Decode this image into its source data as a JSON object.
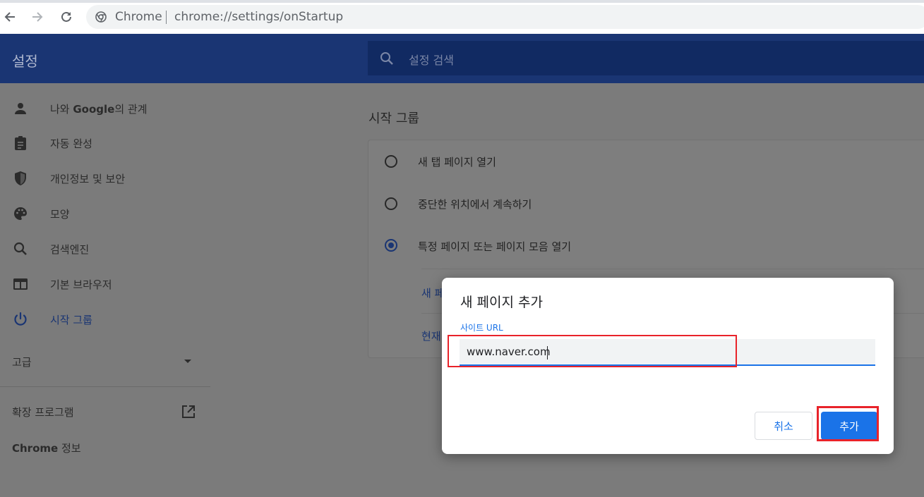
{
  "browser": {
    "chrome_label": "Chrome",
    "url": "chrome://settings/onStartup"
  },
  "header": {
    "title": "설정",
    "search_placeholder": "설정 검색"
  },
  "sidebar": {
    "items": [
      {
        "label_pre": "나와 ",
        "label_bold": "Google",
        "label_post": "의 관계",
        "icon": "person-icon"
      },
      {
        "label": "자동 완성",
        "icon": "clipboard-icon"
      },
      {
        "label": "개인정보 및 보안",
        "icon": "shield-icon"
      },
      {
        "label": "모양",
        "icon": "palette-icon"
      },
      {
        "label": "검색엔진",
        "icon": "search-icon"
      },
      {
        "label": "기본 브라우저",
        "icon": "browser-window-icon"
      },
      {
        "label": "시작 그룹",
        "icon": "power-icon",
        "active": true
      }
    ],
    "advanced": "고급",
    "extensions": "확장 프로그램",
    "about_bold": "Chrome",
    "about_post": " 정보"
  },
  "main": {
    "section_title": "시작 그룹",
    "options": [
      {
        "label": "새 탭 페이지 열기",
        "selected": false
      },
      {
        "label": "중단한 위치에서 계속하기",
        "selected": false
      },
      {
        "label": "특정 페이지 또는 페이지 모음 열기",
        "selected": true
      }
    ],
    "link_new_page": "새 페",
    "link_current": "현재"
  },
  "dialog": {
    "title": "새 페이지 추가",
    "field_label": "사이트 URL",
    "url_value": "www.naver.com",
    "cancel_label": "취소",
    "add_label": "추가"
  },
  "colors": {
    "header_bg": "#1a3573",
    "accent": "#1a73e8",
    "highlight": "#e8232a"
  }
}
